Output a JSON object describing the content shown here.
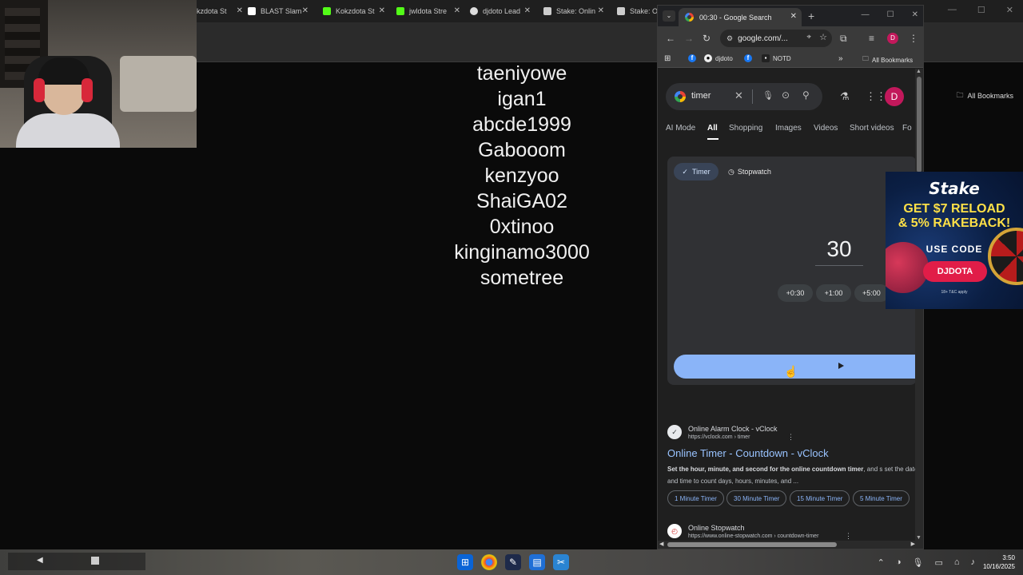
{
  "background_browser": {
    "tabs": [
      {
        "label": "kzdota St",
        "color": "#4caf50"
      },
      {
        "label": "BLAST Slam",
        "color": "#ffffff"
      },
      {
        "label": "Kokzdota St",
        "color": "#53fc18"
      },
      {
        "label": "jwldota Stre",
        "color": "#53fc18"
      },
      {
        "label": "djdoto Lead",
        "color": "#dddddd"
      },
      {
        "label": "Stake: Onlin",
        "color": "#cccccc"
      },
      {
        "label": "Stake: Onl",
        "color": "#cccccc"
      }
    ],
    "bookmarks_label": "All Bookmarks"
  },
  "names_list": [
    "taeniyowe",
    "igan1",
    "abcde1999",
    "Gabooom",
    "kenzyoo",
    "ShaiGA02",
    "0xtinoo",
    "kinginamo3000",
    "sometree"
  ],
  "chrome": {
    "active_tab_title": "00:30 - Google Search",
    "omnibox_url": "google.com/...",
    "profile_initial": "D",
    "bookmarks": [
      {
        "label": "",
        "icon": "facebook-icon"
      },
      {
        "label": "djdoto",
        "icon": "github-icon"
      },
      {
        "label": "",
        "icon": "facebook-icon"
      },
      {
        "label": "NOTD",
        "icon": "notd-icon"
      }
    ],
    "all_bookmarks_label": "All Bookmarks"
  },
  "search": {
    "query": "timer",
    "profile_initial": "D",
    "filters": [
      "AI Mode",
      "All",
      "Shopping",
      "Images",
      "Videos",
      "Short videos",
      "Fo"
    ],
    "active_filter": "All"
  },
  "timer": {
    "tab_timer": "Timer",
    "tab_stopwatch": "Stopwatch",
    "value": "30",
    "increments": [
      "+0:30",
      "+1:00",
      "+5:00"
    ]
  },
  "results": [
    {
      "site": "Online Alarm Clock - vClock",
      "url": "https://vclock.com › timer",
      "title": "Online Timer - Countdown - vClock",
      "snippet_bold": "Set the hour, minute, and second for the online countdown timer",
      "snippet_rest": ", and s set the date and time to count days, hours, minutes, and ...",
      "chips": [
        "1 Minute Timer",
        "30 Minute Timer",
        "15 Minute Timer",
        "5 Minute Timer"
      ]
    },
    {
      "site": "Online Stopwatch",
      "url": "https://www.online-stopwatch.com › countdown-timer"
    }
  ],
  "ad": {
    "brand": "Stake",
    "headline_1": "GET $7 RELOAD",
    "headline_2": "& 5% RAKEBACK!",
    "use_code": "USE CODE",
    "code": "DJDOTA",
    "terms": "18+ T&C apply"
  },
  "taskbar": {
    "time": "3:50",
    "date": "10/16/2025"
  }
}
